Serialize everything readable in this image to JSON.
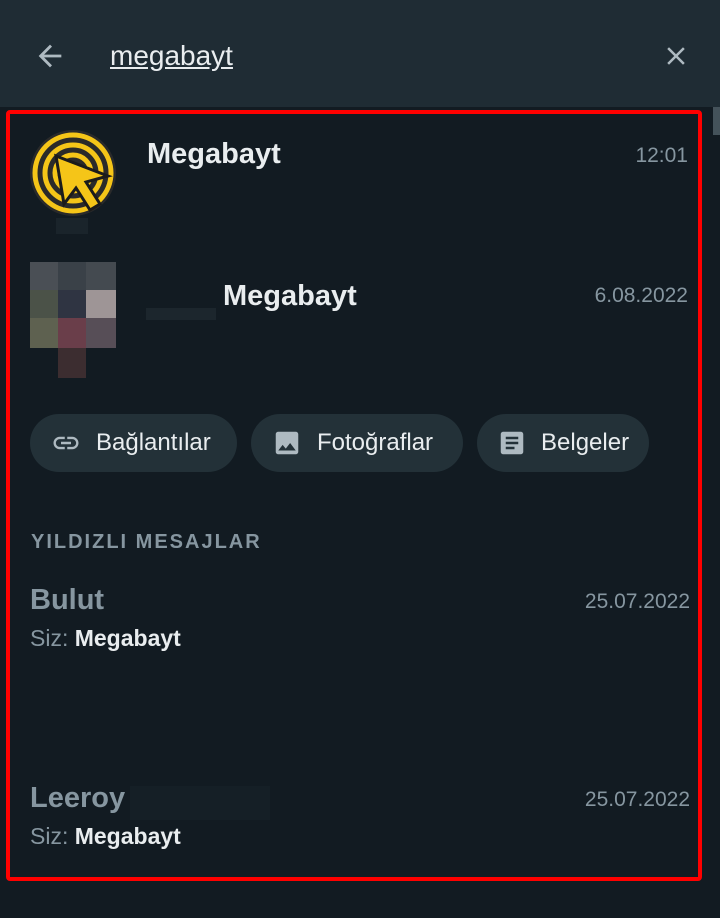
{
  "search": {
    "query": "megabayt",
    "back_icon": "arrow-left-icon",
    "close_icon": "close-icon"
  },
  "chats": [
    {
      "name": "Megabayt",
      "time": "12:01",
      "avatar": "megabayt-logo-icon"
    },
    {
      "name": "Megabayt",
      "time": "6.08.2022",
      "avatar": "pixelated-avatar"
    }
  ],
  "chips": [
    {
      "label": "Bağlantılar",
      "icon": "link-icon"
    },
    {
      "label": "Fotoğraflar",
      "icon": "image-icon"
    },
    {
      "label": "Belgeler",
      "icon": "document-icon"
    }
  ],
  "starred": {
    "title": "YILDIZLI MESAJLAR",
    "messages": [
      {
        "name": "Bulut",
        "prefix": "Siz:",
        "text": "Megabayt",
        "date": "25.07.2022"
      },
      {
        "name": "Leeroy",
        "prefix": "Siz:",
        "text": "Megabayt",
        "date": "25.07.2022"
      }
    ]
  },
  "colors": {
    "background": "#121b22",
    "header": "#1f2c34",
    "chip": "#233138",
    "highlight": "#ff0000",
    "logo_yellow": "#f5c518"
  }
}
